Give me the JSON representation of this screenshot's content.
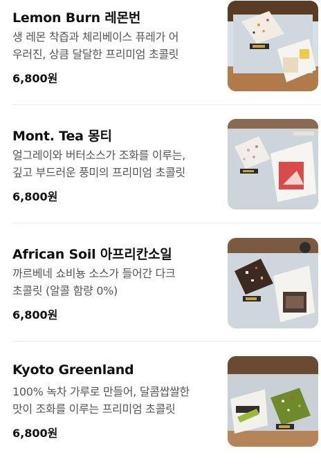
{
  "products": [
    {
      "name": "Lemon Burn 레몬번",
      "description_lines": [
        "생 레몬 착즙과 체리베이스 퓨레가 어",
        "우러진, 상큼 달달한 프리미엄 초콜릿"
      ],
      "price": "6,800원",
      "image_icon": "chocolate-box-photo"
    },
    {
      "name": "Mont. Tea 몽티",
      "description_lines": [
        "얼그레이와 버터소스가 조화를 이루는,",
        "깊고 부드러운 풍미의 프리미엄 초콜릿"
      ],
      "price": "6,800원",
      "image_icon": "chocolate-box-photo"
    },
    {
      "name": "African Soil 아프리칸소일",
      "description_lines": [
        "까르베네 쇼비뇽 소스가 들어간 다크",
        "초콜릿 (알콜 함량 0%)"
      ],
      "price": "6,800원",
      "image_icon": "chocolate-box-photo"
    },
    {
      "name": "Kyoto Greenland",
      "description_lines": [
        "100% 녹차 가루로 만들어, 달콤쌉쌀한",
        "맛이 조화를 이루는 프리미엄 초콜릿"
      ],
      "price": "6,800원",
      "image_icon": "chocolate-box-photo"
    }
  ]
}
